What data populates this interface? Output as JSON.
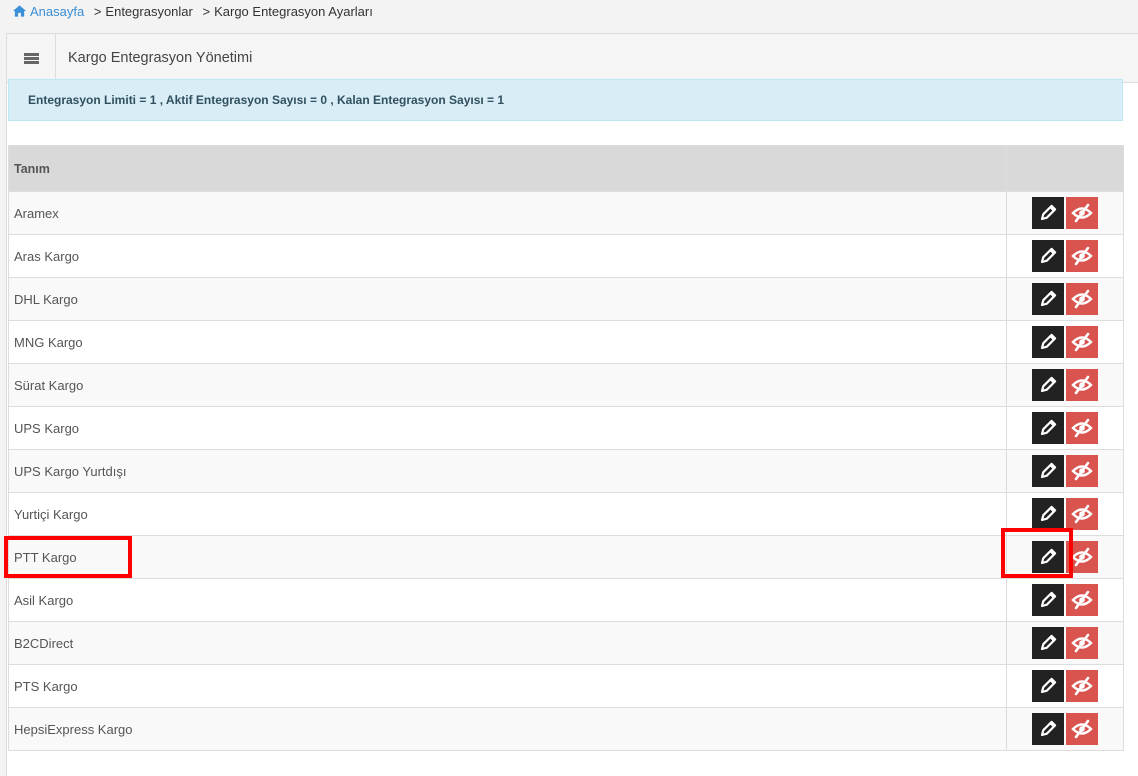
{
  "breadcrumb": {
    "home_label": "Anasayfa",
    "separator": ">",
    "items": [
      "Entegrasyonlar",
      "Kargo Entegrasyon Ayarları"
    ]
  },
  "panel": {
    "title": "Kargo Entegrasyon Yönetimi"
  },
  "info_bar": {
    "text": "Entegrasyon Limiti = 1 , Aktif Entegrasyon Sayısı = 0 , Kalan Entegrasyon Sayısı = 1"
  },
  "table": {
    "columns": [
      "Tanım",
      ""
    ],
    "rows": [
      {
        "name": "Aramex"
      },
      {
        "name": "Aras Kargo"
      },
      {
        "name": "DHL Kargo"
      },
      {
        "name": "MNG Kargo"
      },
      {
        "name": "Sürat Kargo"
      },
      {
        "name": "UPS Kargo"
      },
      {
        "name": "UPS Kargo Yurtdışı"
      },
      {
        "name": "Yurtiçi Kargo"
      },
      {
        "name": "PTT Kargo"
      },
      {
        "name": "Asil Kargo"
      },
      {
        "name": "B2CDirect"
      },
      {
        "name": "PTS Kargo"
      },
      {
        "name": "HepsiExpress Kargo"
      }
    ],
    "row_actions": {
      "edit_icon": "pencil-icon",
      "hide_icon": "eye-slash-icon"
    }
  },
  "colors": {
    "accent_link": "#3a8fd6",
    "edit_button": "#222222",
    "hide_button": "#d9534f",
    "info_background": "#d9edf7",
    "annotation": "#ff0000"
  }
}
